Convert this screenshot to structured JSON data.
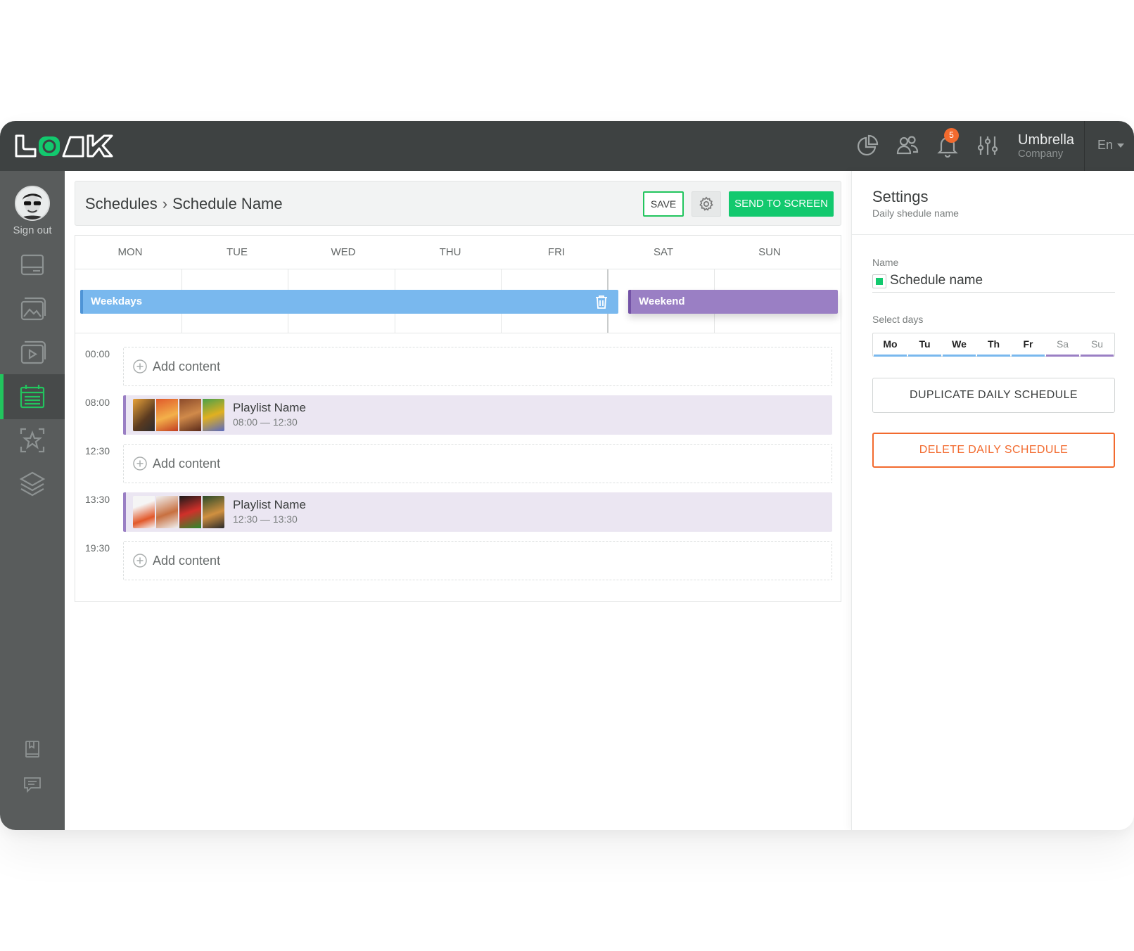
{
  "app": {
    "logo_text": "LOOK",
    "notifications_count": "5",
    "company_name": "Umbrella",
    "company_sub": "Company",
    "language": "En"
  },
  "topbar_icons": [
    "analytics-icon",
    "users-icon",
    "bell-icon",
    "sliders-icon"
  ],
  "sidebar": {
    "signout_label": "Sign out",
    "items": [
      {
        "icon": "screen-icon",
        "active": false
      },
      {
        "icon": "image-icon",
        "active": false
      },
      {
        "icon": "video-icon",
        "active": false
      },
      {
        "icon": "calendar-icon",
        "active": true
      },
      {
        "icon": "star-icon",
        "active": false
      },
      {
        "icon": "layers-icon",
        "active": false
      }
    ],
    "bottom_items": [
      {
        "icon": "book-icon"
      },
      {
        "icon": "chat-icon"
      }
    ]
  },
  "header": {
    "breadcrumb_root": "Schedules",
    "breadcrumb_sep": "›",
    "breadcrumb_current": "Schedule Name",
    "save_label": "SAVE",
    "send_label": "SEND TO SCREEN"
  },
  "calendar": {
    "days": [
      "MON",
      "TUE",
      "WED",
      "THU",
      "FRI",
      "SAT",
      "SUN"
    ],
    "weekdays_label": "Weekdays",
    "weekend_label": "Weekend"
  },
  "timeline": [
    {
      "time": "00:00",
      "type": "add",
      "label": "Add content"
    },
    {
      "time": "08:00",
      "type": "playlist",
      "name": "Playlist Name",
      "range": "08:00 — 12:30"
    },
    {
      "time": "12:30",
      "type": "add",
      "label": "Add content"
    },
    {
      "time": "13:30",
      "type": "playlist",
      "name": "Playlist Name",
      "range": "12:30 — 13:30"
    },
    {
      "time": "19:30",
      "type": "add",
      "label": "Add content"
    }
  ],
  "settings": {
    "title": "Settings",
    "subtitle": "Daily shedule name",
    "name_label": "Name",
    "name_value": "Schedule name",
    "select_days_label": "Select days",
    "days": [
      {
        "label": "Mo",
        "selected": true
      },
      {
        "label": "Tu",
        "selected": true
      },
      {
        "label": "We",
        "selected": true
      },
      {
        "label": "Th",
        "selected": true
      },
      {
        "label": "Fr",
        "selected": true
      },
      {
        "label": "Sa",
        "selected": false
      },
      {
        "label": "Su",
        "selected": false
      }
    ],
    "duplicate_label": "DUPLICATE DAILY SCHEDULE",
    "delete_label": "DELETE DAILY SCHEDULE"
  },
  "colors": {
    "accent_green": "#12c96e",
    "weekdays_blue": "#79b8ee",
    "weekend_purple": "#9a7fc4",
    "danger_orange": "#f26a2e",
    "topbar": "#3e4242",
    "sidebar": "#595c5c"
  }
}
